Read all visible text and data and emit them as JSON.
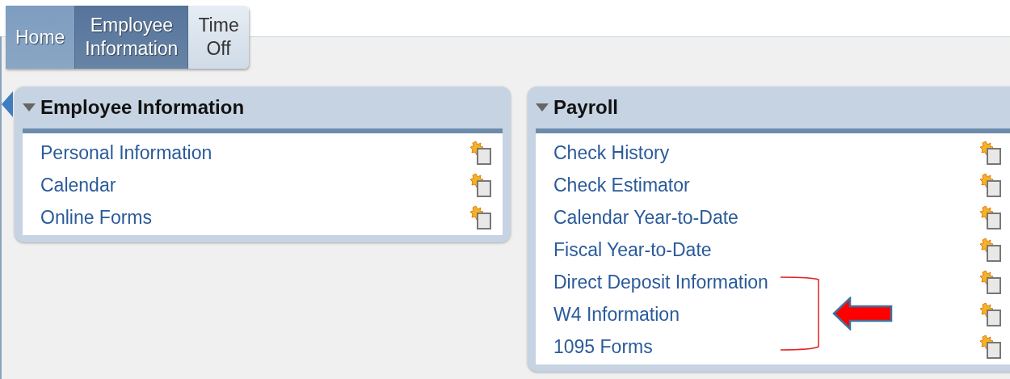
{
  "tabs": [
    {
      "label": "Home",
      "kind": "home",
      "selected": false
    },
    {
      "label": "Employee\nInformation",
      "kind": "tab",
      "selected": true
    },
    {
      "label": "Time\nOff",
      "kind": "tab",
      "selected": false
    }
  ],
  "panels": [
    {
      "title": "Employee Information",
      "expanded": true,
      "links": [
        "Personal Information",
        "Calendar",
        "Online Forms"
      ]
    },
    {
      "title": "Payroll",
      "expanded": true,
      "links": [
        "Check History",
        "Check Estimator",
        "Calendar Year-to-Date",
        "Fiscal Year-to-Date",
        "Direct Deposit Information",
        "W4 Information",
        "1095 Forms"
      ]
    }
  ]
}
